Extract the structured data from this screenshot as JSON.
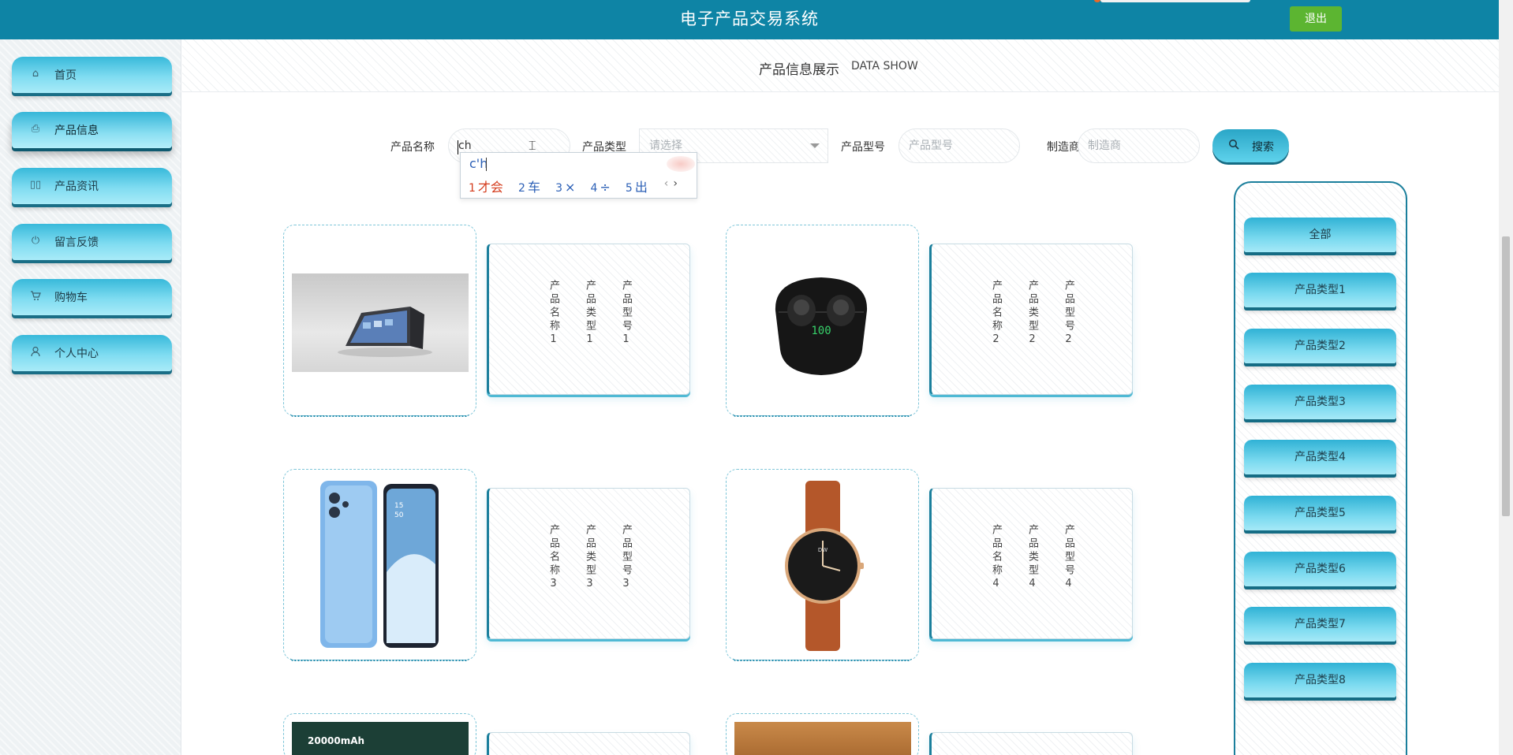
{
  "header": {
    "title": "电子产品交易系统",
    "logout_label": "退出"
  },
  "sidebar": {
    "items": [
      {
        "label": "首页",
        "icon": "home-icon"
      },
      {
        "label": "产品信息",
        "icon": "printer-icon"
      },
      {
        "label": "产品资讯",
        "icon": "columns-icon"
      },
      {
        "label": "留言反馈",
        "icon": "power-icon"
      },
      {
        "label": "购物车",
        "icon": "cart-icon"
      },
      {
        "label": "个人中心",
        "icon": "user-icon"
      }
    ],
    "active_index": 1
  },
  "section": {
    "title_cn": "产品信息展示",
    "title_en": "DATA SHOW"
  },
  "search": {
    "name_label": "产品名称",
    "name_value": "ch",
    "type_label": "产品类型",
    "type_placeholder": "请选择",
    "model_label": "产品型号",
    "model_placeholder": "产品型号",
    "maker_label": "制造商",
    "maker_placeholder": "制造商",
    "button_label": "搜索"
  },
  "ime": {
    "composition": "c'h",
    "candidates": [
      {
        "num": "1",
        "text": "才会"
      },
      {
        "num": "2",
        "text": "车"
      },
      {
        "num": "3",
        "text": "×"
      },
      {
        "num": "4",
        "text": "÷"
      },
      {
        "num": "5",
        "text": "出"
      }
    ],
    "prev": "‹",
    "next": "›"
  },
  "products": [
    {
      "name": "产品名称1",
      "type": "产品类型1",
      "model": "产品型号1",
      "image": "tablet-stand-photo"
    },
    {
      "name": "产品名称2",
      "type": "产品类型2",
      "model": "产品型号2",
      "image": "earbuds-photo"
    },
    {
      "name": "产品名称3",
      "type": "产品类型3",
      "model": "产品型号3",
      "image": "smartphone-photo"
    },
    {
      "name": "产品名称4",
      "type": "产品类型4",
      "model": "产品型号4",
      "image": "watch-photo"
    },
    {
      "name": "",
      "type": "",
      "model": "",
      "image": "powerbank-photo",
      "image_text": "20000mAh"
    },
    {
      "name": "",
      "type": "",
      "model": "",
      "image": "wood-photo"
    }
  ],
  "categories": [
    "全部",
    "产品类型1",
    "产品类型2",
    "产品类型3",
    "产品类型4",
    "产品类型5",
    "产品类型6",
    "产品类型7",
    "产品类型8"
  ]
}
